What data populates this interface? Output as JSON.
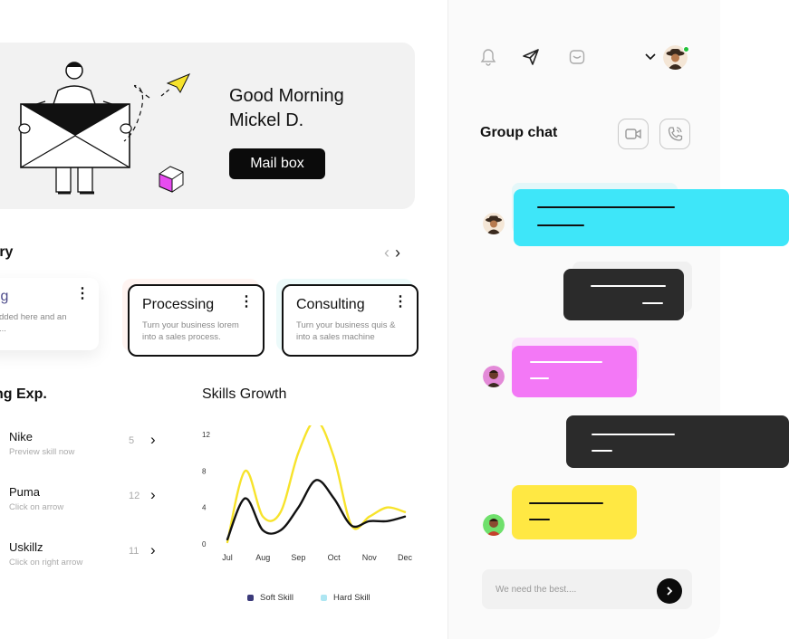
{
  "hero": {
    "greeting_line1": "Good Morning",
    "greeting_line2": "Mickel D.",
    "mailbox_button": "Mail box"
  },
  "industry": {
    "title": "try",
    "cards": [
      {
        "title": "king",
        "desc": "ills added here and an read...",
        "selected": true
      },
      {
        "title": "Processing",
        "desc": "Turn your business lorem into a sales process."
      },
      {
        "title": "Consulting",
        "desc": "Turn your business quis & into a sales machine"
      }
    ]
  },
  "experience": {
    "title": "ng Exp.",
    "items": [
      {
        "name": "Nike",
        "sub": "Preview skill now",
        "count": "5"
      },
      {
        "name": "Puma",
        "sub": "Click on arrow",
        "count": "12"
      },
      {
        "name": "Uskillz",
        "sub": "Click on right arrow",
        "count": "11"
      }
    ]
  },
  "skills": {
    "title": "Skills Growth"
  },
  "chart_data": {
    "type": "line",
    "title": "Skills Growth",
    "categories": [
      "Jul",
      "Aug",
      "Sep",
      "Oct",
      "Nov",
      "Dec"
    ],
    "y_ticks": [
      "0",
      "4",
      "8",
      "12"
    ],
    "ylim": [
      0,
      12
    ],
    "x": [
      0,
      0.5,
      1,
      1.5,
      2,
      2.5,
      3,
      3.5,
      4,
      4.5,
      5
    ],
    "series": [
      {
        "name": "Soft Skill",
        "color": "#111111",
        "values": [
          0.5,
          5,
          1.5,
          1.5,
          4,
          7,
          5,
          2,
          2.5,
          2.5,
          3
        ]
      },
      {
        "name": "Hard Skill",
        "color": "#f7e32b",
        "values": [
          0.2,
          8,
          3,
          3.5,
          10,
          13.5,
          9.5,
          2,
          3,
          4,
          3.5
        ]
      }
    ],
    "legend": [
      {
        "label": "Soft Skill",
        "color": "#3b3a7a"
      },
      {
        "label": "Hard Skill",
        "color": "#aee6f2"
      }
    ],
    "grid": false,
    "legend_position": "bottom"
  },
  "chat": {
    "title": "Group chat",
    "input_placeholder": "We need the best...."
  },
  "icons": {
    "notification": "bell-icon",
    "send": "paper-plane-icon",
    "inbox": "inbox-icon",
    "dropdown": "chevron-down-icon",
    "video": "video-icon",
    "call": "phone-icon",
    "send_message": "chevron-right-icon"
  },
  "colors": {
    "bubble_cyan": "#3ee6f9",
    "bubble_dark": "#2b2b2b",
    "bubble_pink": "#f378f6",
    "bubble_yellow": "#ffe843",
    "online": "#21c13a"
  }
}
